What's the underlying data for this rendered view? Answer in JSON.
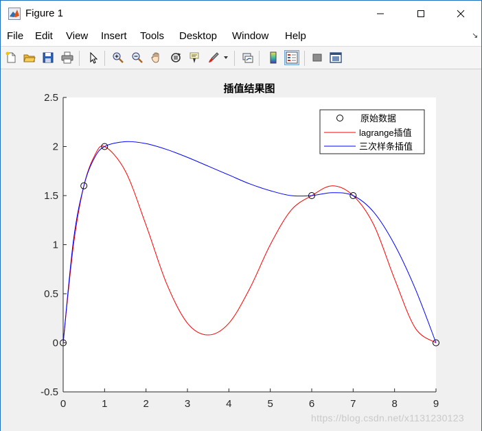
{
  "window": {
    "title": "Figure 1",
    "controls": {
      "minimize": "—",
      "maximize": "☐",
      "close": "✕"
    }
  },
  "menubar": {
    "items": [
      "File",
      "Edit",
      "View",
      "Insert",
      "Tools",
      "Desktop",
      "Window",
      "Help"
    ]
  },
  "toolbar": {
    "buttons": [
      "new-figure-icon",
      "open-file-icon",
      "save-icon",
      "print-icon",
      "select-arrow-icon",
      "zoom-in-icon",
      "zoom-out-icon",
      "pan-hand-icon",
      "rotate-3d-icon",
      "data-cursor-icon",
      "brush-icon",
      "brush-dropdown-icon",
      "link-plot-icon",
      "colorbar-icon",
      "legend-icon",
      "hide-plot-tools-icon",
      "show-plot-tools-icon"
    ],
    "active": "legend-icon"
  },
  "chart_data": {
    "type": "line",
    "title": "插值结果图",
    "xlim": [
      0,
      9
    ],
    "ylim": [
      -0.5,
      2.5
    ],
    "xticks": [
      "0",
      "1",
      "2",
      "3",
      "4",
      "5",
      "6",
      "7",
      "8",
      "9"
    ],
    "yticks": [
      "-0.5",
      "0",
      "0.5",
      "1",
      "1.5",
      "2",
      "2.5"
    ],
    "grid": false,
    "legend_position": "top-right",
    "series": [
      {
        "name": "原始数据",
        "style": "markers",
        "marker": "circle",
        "color": "#000000",
        "x": [
          0,
          0.5,
          1,
          6,
          7,
          9
        ],
        "y": [
          0,
          1.6,
          2,
          1.5,
          1.5,
          0
        ]
      },
      {
        "name": "lagrange插值",
        "style": "line",
        "color": "#ff0000",
        "x": [
          0,
          0.25,
          0.5,
          0.75,
          1,
          1.5,
          2,
          2.5,
          3,
          3.5,
          4,
          4.5,
          5,
          5.5,
          6,
          6.5,
          7,
          7.5,
          8,
          8.5,
          9
        ],
        "y": [
          0,
          1.0,
          1.6,
          1.9,
          2.0,
          1.75,
          1.2,
          0.6,
          0.2,
          0.08,
          0.2,
          0.55,
          1.0,
          1.35,
          1.5,
          1.6,
          1.5,
          1.2,
          0.65,
          0.15,
          0
        ]
      },
      {
        "name": "三次样条插值",
        "style": "line",
        "color": "#0000ff",
        "x": [
          0,
          0.25,
          0.5,
          0.75,
          1,
          1.5,
          2,
          2.5,
          3,
          3.5,
          4,
          4.5,
          5,
          5.5,
          6,
          6.5,
          7,
          7.5,
          8,
          8.5,
          9
        ],
        "y": [
          0,
          1.05,
          1.6,
          1.88,
          2.0,
          2.05,
          2.03,
          1.97,
          1.89,
          1.8,
          1.71,
          1.62,
          1.55,
          1.5,
          1.5,
          1.53,
          1.5,
          1.33,
          1.0,
          0.55,
          0
        ]
      }
    ]
  },
  "watermark": "https://blog.csdn.net/x1131230123"
}
